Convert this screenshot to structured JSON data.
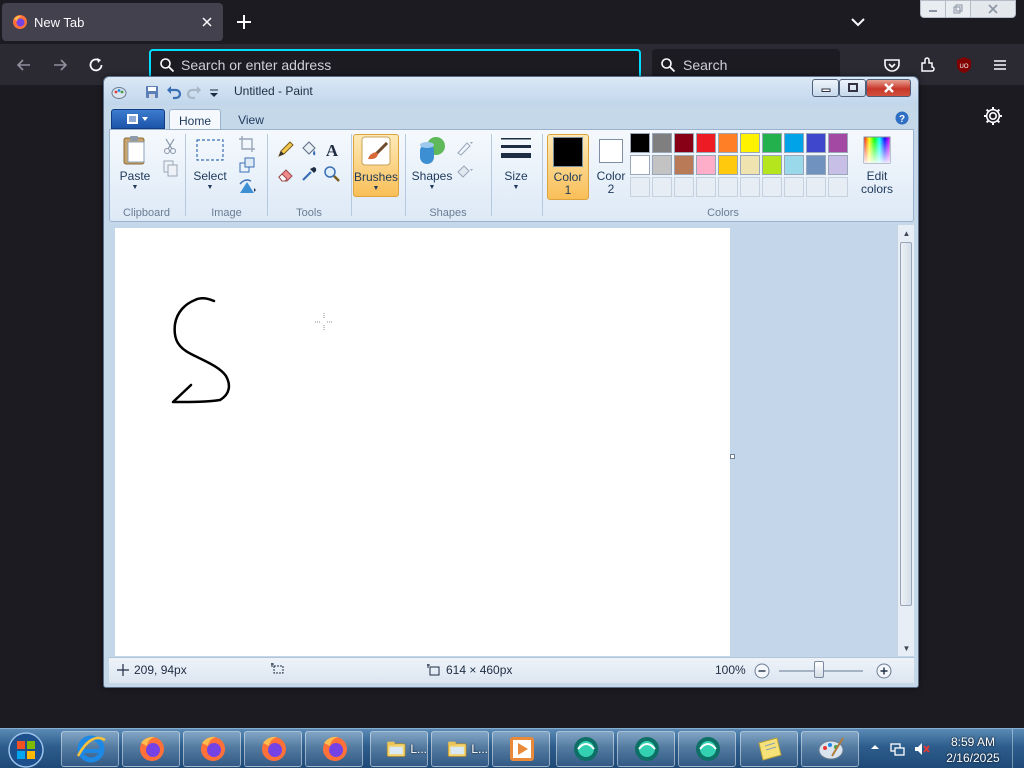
{
  "browser": {
    "tab": {
      "title": "New Tab",
      "favicon": "firefox-icon",
      "close_icon": "close-icon"
    },
    "new_tab_icon": "plus-icon",
    "tab_list_icon": "chevron-down-icon",
    "window_controls": [
      "minimize-icon",
      "restore-icon",
      "close-icon"
    ],
    "nav": {
      "back_icon": "arrow-left-icon",
      "forward_icon": "arrow-right-icon",
      "reload_icon": "reload-icon"
    },
    "urlbar": {
      "placeholder": "Search or enter address",
      "value": ""
    },
    "searchbar": {
      "placeholder": "Search"
    },
    "toolbar_icons": [
      "pocket-icon",
      "extensions-icon",
      "ublock-icon",
      "hamburger-menu-icon"
    ],
    "ublock_badge": "UO",
    "settings_icon": "gear-icon",
    "accent": "#00ddff"
  },
  "paint": {
    "title": "Untitled - Paint",
    "tabs": [
      "Home",
      "View"
    ],
    "active_tab": "Home",
    "groups": {
      "clipboard": {
        "label": "Clipboard",
        "paste": "Paste"
      },
      "image": {
        "label": "Image",
        "select": "Select"
      },
      "tools": {
        "label": "Tools"
      },
      "brushes": "Brushes",
      "shapes": {
        "label": "Shapes",
        "button": "Shapes"
      },
      "size": "Size",
      "colors": {
        "label": "Colors",
        "color1": [
          "Color",
          "1"
        ],
        "color2": [
          "Color",
          "2"
        ],
        "edit": [
          "Edit",
          "colors"
        ],
        "color1_value": "#000000",
        "color2_value": "#ffffff",
        "palette_row1": [
          "#000000",
          "#7f7f7f",
          "#880015",
          "#ed1c24",
          "#ff7f27",
          "#fff200",
          "#22b14c",
          "#00a2e8",
          "#3f48cc",
          "#a349a4"
        ],
        "palette_row2": [
          "#ffffff",
          "#c3c3c3",
          "#b97a57",
          "#ffaec9",
          "#ffc90e",
          "#efe4b0",
          "#b5e61d",
          "#99d9ea",
          "#7092be",
          "#c8bfe7"
        ],
        "palette_row3": [
          "",
          "",
          "",
          "",
          "",
          "",
          "",
          "",
          "",
          ""
        ]
      }
    },
    "drawing": {
      "description": "S",
      "stroke": "#000000"
    },
    "status": {
      "cursor_pos": "209, 94px",
      "selection_size": "",
      "canvas_size": "614 × 460px",
      "zoom": "100%"
    }
  },
  "taskbar": {
    "apps": [
      {
        "icon": "internet-explorer-icon",
        "label": ""
      },
      {
        "icon": "firefox-icon",
        "label": ""
      },
      {
        "icon": "firefox-icon",
        "label": ""
      },
      {
        "icon": "firefox-icon",
        "label": ""
      },
      {
        "icon": "firefox-icon",
        "label": ""
      },
      {
        "icon": "file-explorer-icon",
        "label": "L..."
      },
      {
        "icon": "file-explorer-icon",
        "label": "L..."
      },
      {
        "icon": "media-player-icon",
        "label": ""
      },
      {
        "icon": "teal-app-icon",
        "label": ""
      },
      {
        "icon": "teal-app-icon",
        "label": ""
      },
      {
        "icon": "teal-app-icon",
        "label": ""
      },
      {
        "icon": "notes-icon",
        "label": ""
      },
      {
        "icon": "paint-icon",
        "label": ""
      }
    ],
    "tray_icons": [
      "show-hidden-icons-icon",
      "network-icon",
      "volume-muted-icon"
    ],
    "clock": {
      "time": "8:59 AM",
      "date": "2/16/2025"
    }
  }
}
